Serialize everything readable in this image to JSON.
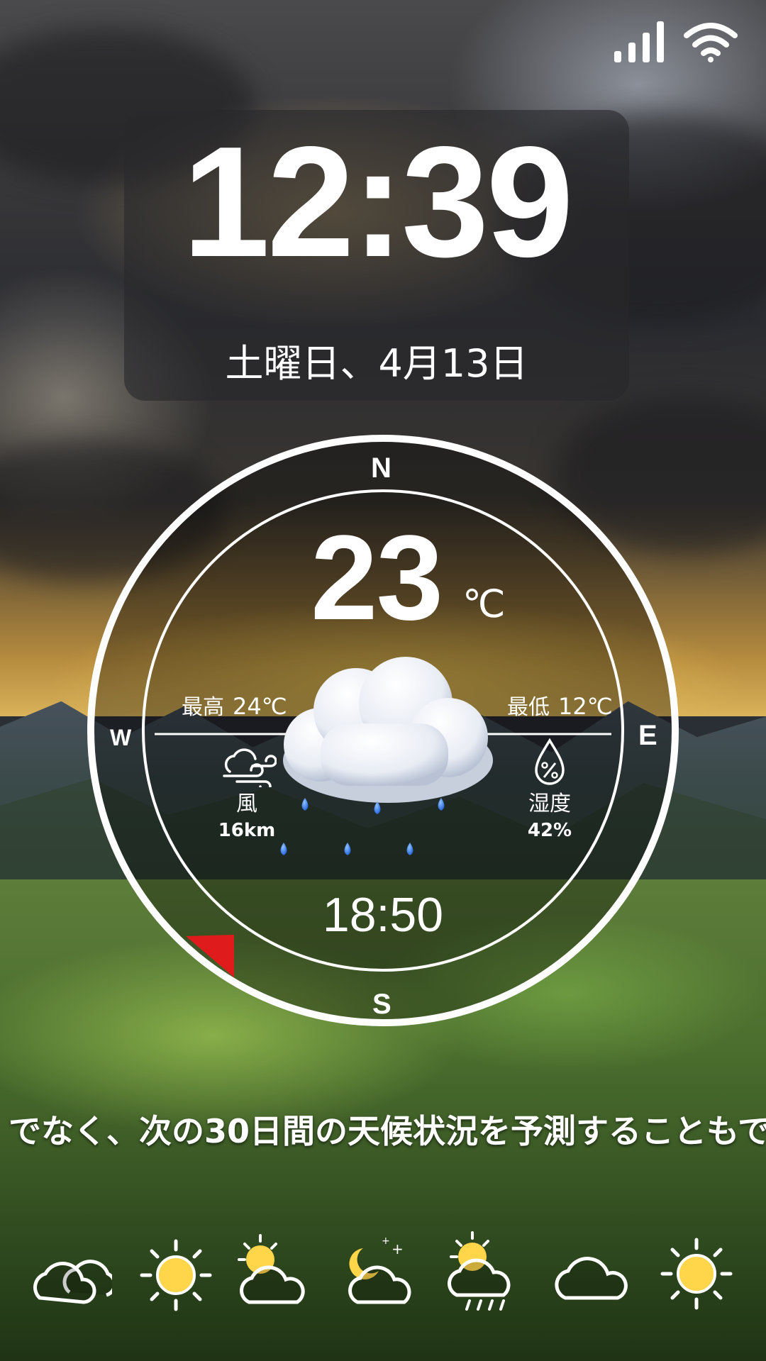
{
  "status_bar": {
    "signal_icon": "signal-icon",
    "wifi_icon": "wifi-icon"
  },
  "clock": {
    "time": "12:39",
    "date": "土曜日、4月13日"
  },
  "compass": {
    "north": "N",
    "south": "S",
    "east": "E",
    "west": "W"
  },
  "weather": {
    "temperature": "23",
    "unit": "℃",
    "high_label": "最高",
    "high_value": "24℃",
    "low_label": "最低",
    "low_value": "12℃",
    "condition_icon": "rain-cloud-icon",
    "wind": {
      "label": "風",
      "value": "16km",
      "icon": "wind-icon"
    },
    "humidity": {
      "label": "湿度",
      "value": "42%",
      "icon": "humidity-icon"
    },
    "sunset_time": "18:50"
  },
  "ticker_text": "でなく、次の30日間の天候状況を予測することもで",
  "forecast": [
    {
      "icon": "cloudy-icon"
    },
    {
      "icon": "sunny-icon"
    },
    {
      "icon": "partly-cloudy-icon"
    },
    {
      "icon": "night-partly-cloudy-icon"
    },
    {
      "icon": "sun-rain-icon"
    },
    {
      "icon": "cloud-icon"
    },
    {
      "icon": "sunny-icon"
    }
  ],
  "colors": {
    "accent_marker": "#e01b1b",
    "text": "#ffffff",
    "panel": "#28282c"
  }
}
